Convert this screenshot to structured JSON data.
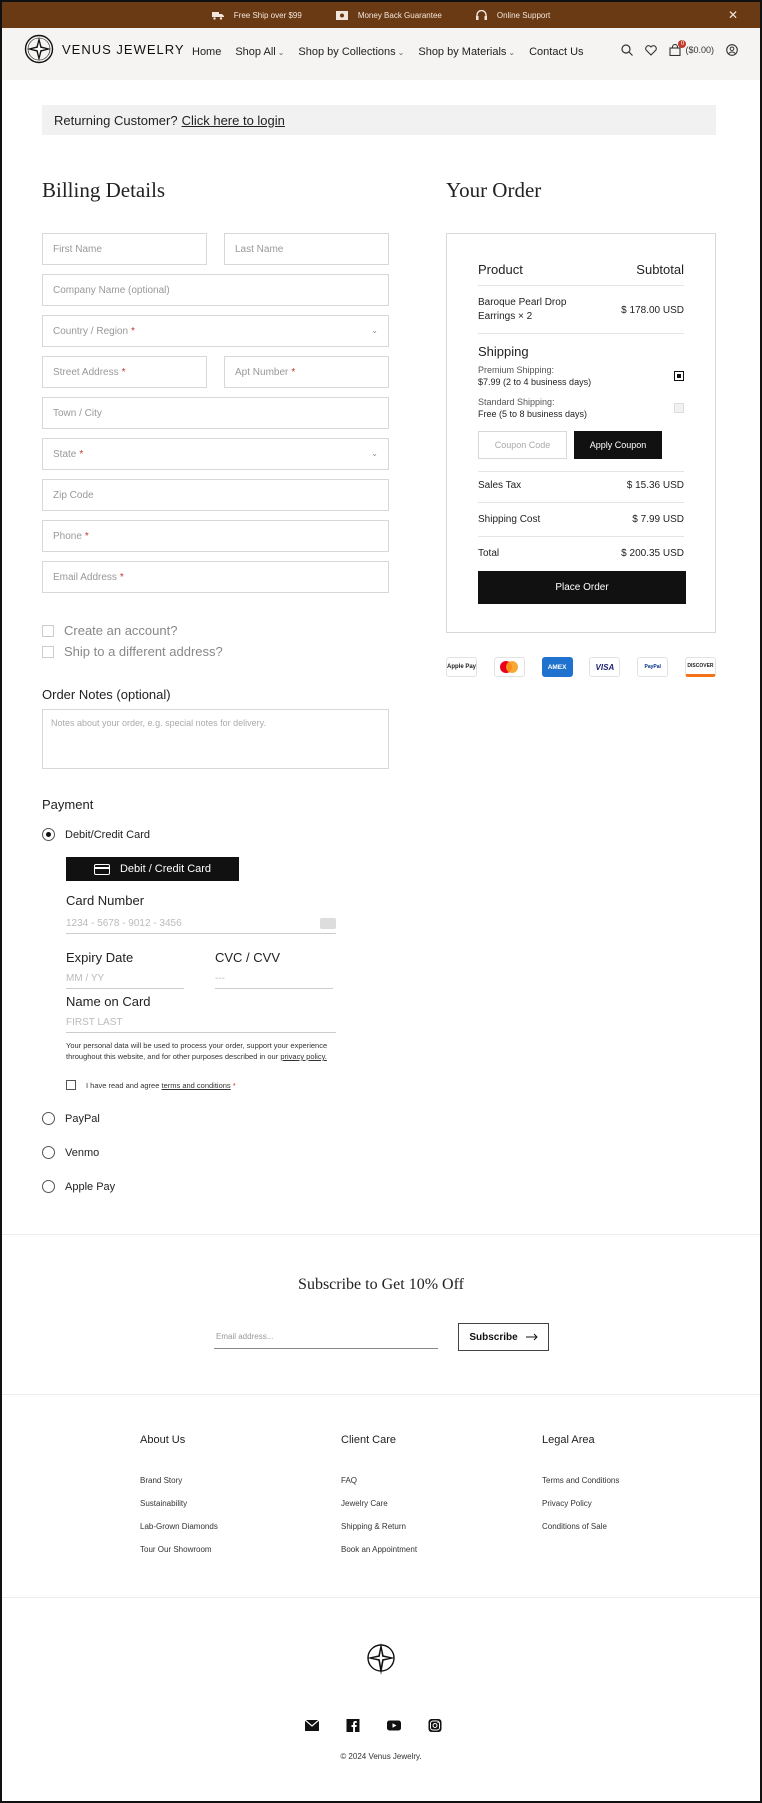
{
  "topbar": {
    "items": [
      "Free Ship over $99",
      "Money Back Guarantee",
      "Online Support"
    ],
    "close": "✕"
  },
  "header": {
    "brand": "VENUS JEWELRY",
    "nav": [
      "Home",
      "Shop All",
      "Shop by Collections",
      "Shop by Materials",
      "Contact Us"
    ],
    "cart_amount": "($0.00)",
    "cart_count": "0"
  },
  "returning": {
    "text": "Returning Customer?",
    "link": "Click here to login"
  },
  "billing": {
    "title": "Billing Details",
    "first_name": "First Name",
    "last_name": "Last Name",
    "company": "Company Name (optional)",
    "country": "Country / Region",
    "street": "Street Address",
    "apt": "Apt Number",
    "town": "Town / City",
    "state": "State",
    "zip": "Zip Code",
    "phone": "Phone",
    "email": "Email Address",
    "required_mark": "*",
    "create_account": "Create an account?",
    "ship_different": "Ship to a different address?",
    "notes_label": "Order Notes (optional)",
    "notes_placeholder": "Notes about your order, e.g. special notes for delivery."
  },
  "payment": {
    "title": "Payment",
    "options": [
      "Debit/Credit Card",
      "PayPal",
      "Venmo",
      "Apple Pay"
    ],
    "card_button": "Debit / Credit Card",
    "card_number_label": "Card Number",
    "card_number_placeholder": "1234 - 5678 - 9012 - 3456",
    "expiry_label": "Expiry Date",
    "expiry_placeholder": "MM / YY",
    "cvc_label": "CVC / CVV",
    "cvc_placeholder": "---",
    "name_label": "Name on Card",
    "name_placeholder": "FIRST LAST",
    "privacy_text": "Your personal data will be used to process your order, support your experience throughout this website, and for other purposes described in our",
    "privacy_link": "privacy policy.",
    "agree_text": "I have read and agree",
    "terms_link": "terms and conditions",
    "required_mark": "*"
  },
  "order": {
    "title": "Your Order",
    "col_product": "Product",
    "col_subtotal": "Subtotal",
    "item_name": "Baroque Pearl Drop",
    "item_name2": "Earrings × 2",
    "item_price": "$ 178.00 USD",
    "shipping_title": "Shipping",
    "premium_line1": "Premium Shipping:",
    "premium_line2": "$7.99 (2 to 4 business days)",
    "standard_line1": "Standard Shipping:",
    "standard_line2": "Free (5 to 8 business days)",
    "coupon_placeholder": "Coupon Code",
    "apply_coupon": "Apply Coupon",
    "sales_tax_label": "Sales Tax",
    "sales_tax_value": "$ 15.36 USD",
    "shipping_cost_label": "Shipping Cost",
    "shipping_cost_value": "$ 7.99 USD",
    "total_label": "Total",
    "total_value": "$ 200.35 USD",
    "place_order": "Place Order"
  },
  "pay_logos": [
    "Apple Pay",
    "Mastercard",
    "AMEX",
    "VISA",
    "PayPal",
    "DISCOVER"
  ],
  "subscribe": {
    "title": "Subscribe to Get 10% Off",
    "placeholder": "Email address...",
    "button": "Subscribe"
  },
  "footer": {
    "about": {
      "title": "About Us",
      "links": [
        "Brand Story",
        "Sustainability",
        "Lab-Grown Diamonds",
        "Tour Our Showroom"
      ]
    },
    "care": {
      "title": "Client Care",
      "links": [
        "FAQ",
        "Jewelry Care",
        "Shipping & Return",
        "Book an Appointment"
      ]
    },
    "legal": {
      "title": "Legal Area",
      "links": [
        "Terms and Conditions",
        "Privacy Policy",
        "Conditions of Sale"
      ]
    },
    "copyright": "© 2024 Venus Jewelry."
  },
  "colors": {
    "topbar": "#6a3a14",
    "header_bg": "#f6f4f2",
    "primary_button": "#111111",
    "required": "#c0392b"
  }
}
